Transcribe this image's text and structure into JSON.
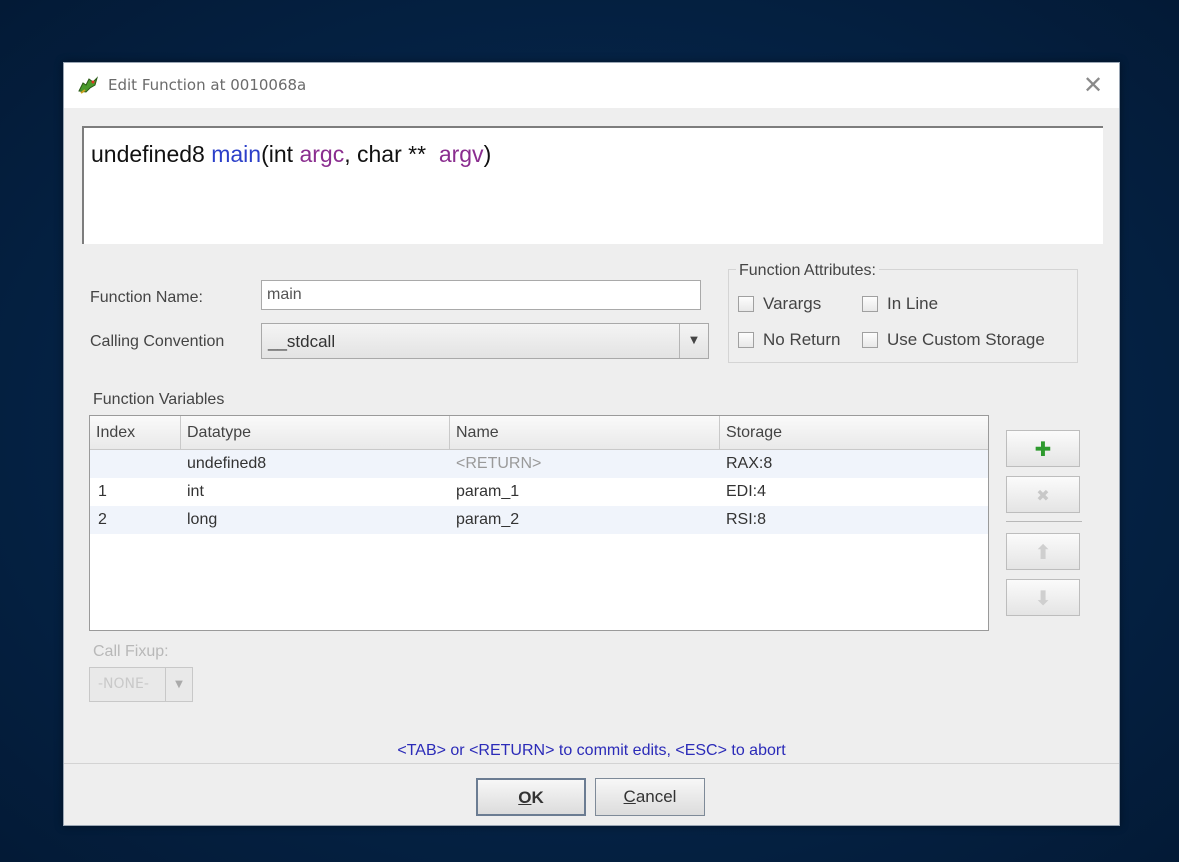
{
  "window": {
    "title": "Edit Function at 0010068a"
  },
  "signature": {
    "return_type": "undefined8",
    "function_name": "main",
    "open_paren": "(",
    "param1_type": "int",
    "param1_name": "argc",
    "separator": ",",
    "param2_type": "char **",
    "param2_name": "argv",
    "close_paren": ")"
  },
  "form": {
    "function_name_label": "Function Name:",
    "function_name_value": "main",
    "calling_convention_label": "Calling Convention",
    "calling_convention_value": "__stdcall"
  },
  "attributes": {
    "title": "Function Attributes:",
    "varargs": "Varargs",
    "in_line": "In Line",
    "no_return": "No Return",
    "use_custom_storage": "Use Custom Storage"
  },
  "variables": {
    "title": "Function Variables",
    "columns": [
      "Index",
      "Datatype",
      "Name",
      "Storage"
    ],
    "rows": [
      {
        "index": "",
        "datatype": "undefined8",
        "name": "<RETURN>",
        "storage": "RAX:8"
      },
      {
        "index": "1",
        "datatype": "int",
        "name": "param_1",
        "storage": "EDI:4"
      },
      {
        "index": "2",
        "datatype": "long",
        "name": "param_2",
        "storage": "RSI:8"
      }
    ]
  },
  "side_buttons": {
    "add": "✚",
    "remove": "✖",
    "up": "⬆",
    "down": "⬇"
  },
  "call_fixup": {
    "label": "Call Fixup:",
    "value": "-NONE-"
  },
  "hint": "<TAB> or <RETURN> to commit edits, <ESC> to abort",
  "buttons": {
    "ok_first": "O",
    "ok_rest": "K",
    "cancel_first": "C",
    "cancel_rest": "ancel"
  },
  "colors": {
    "accent_blue": "#2b3fc9",
    "param_purple": "#8a2d8f",
    "hint_blue": "#2b2bb8",
    "add_green": "#2e9a2e"
  },
  "icons": {
    "app": "dragon-icon",
    "close": "close-icon"
  }
}
